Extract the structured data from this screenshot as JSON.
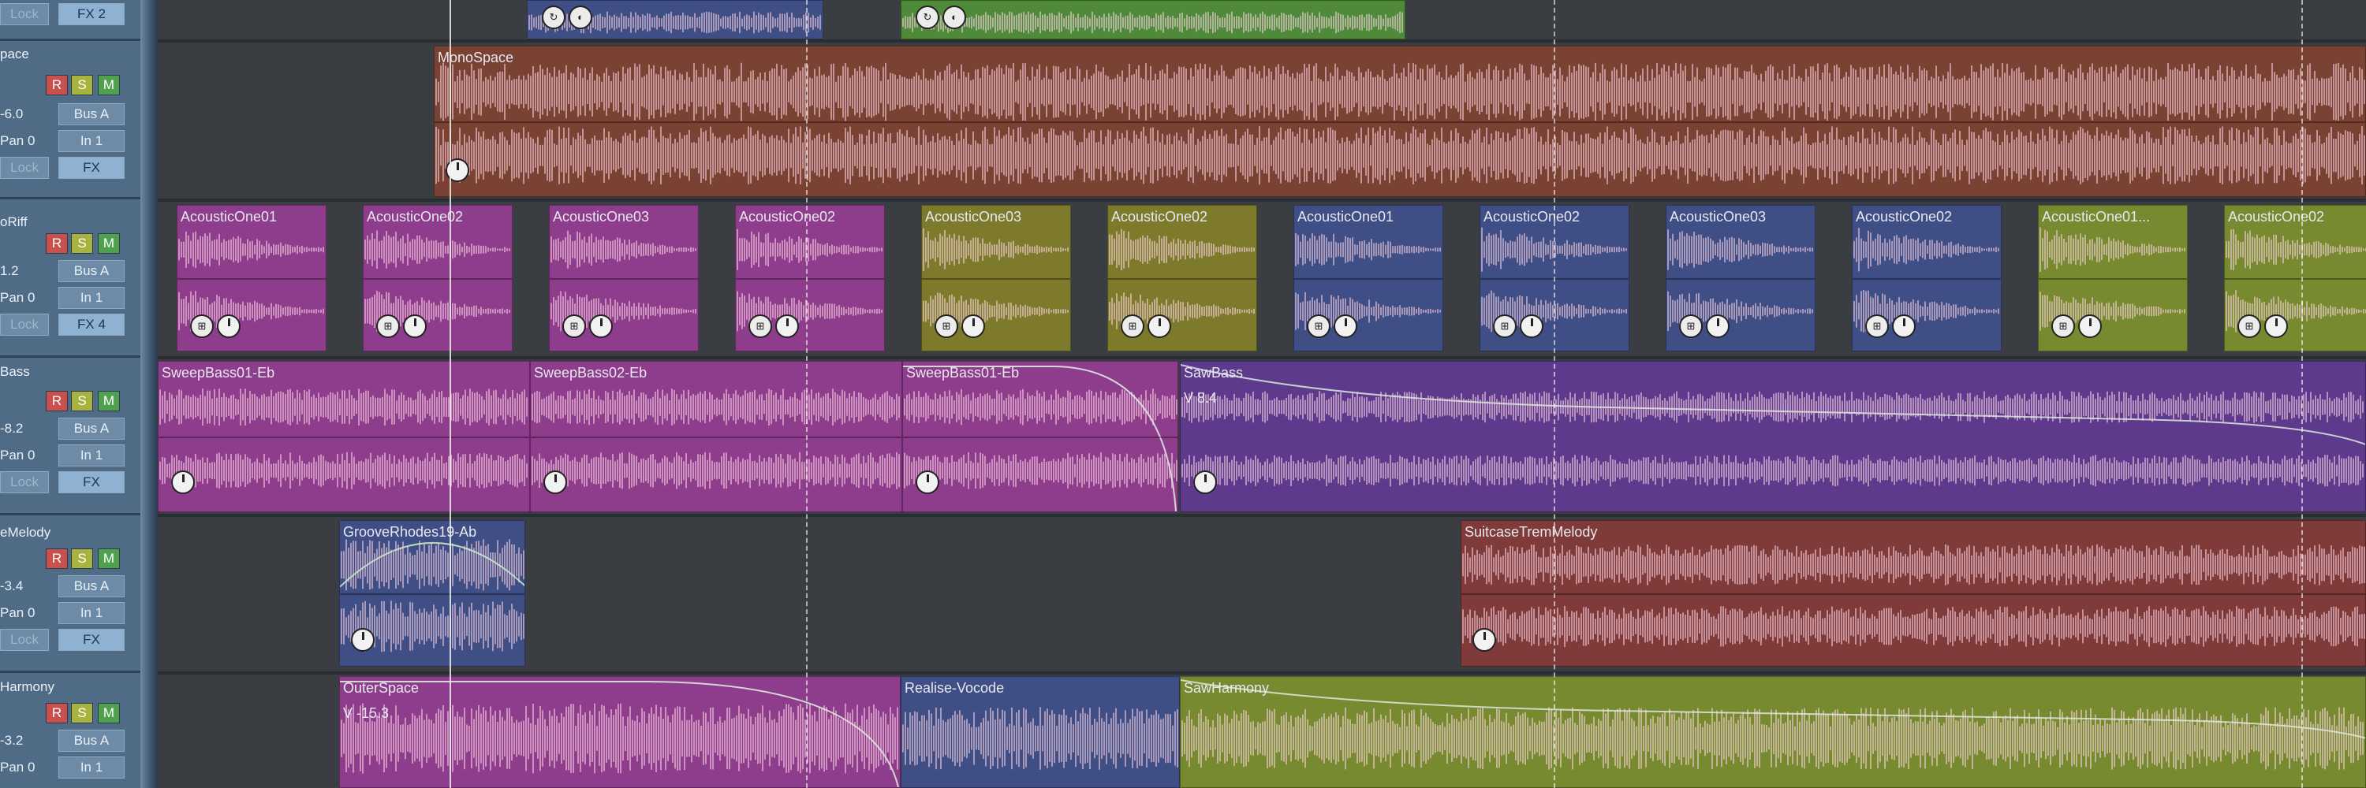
{
  "colors": {
    "header_bg": "#4f6b86",
    "timeline_bg": "#3a3d42",
    "blue_clip": "#3f4f86",
    "green_clip": "#4f8a3a",
    "brown_clip": "#7a4233",
    "magenta_clip": "#8e3d8c",
    "olive_clip": "#7d7a2c",
    "purple_clip": "#5d3a8c",
    "red_clip": "#7f3a3a",
    "yellowgreen_clip": "#788a30"
  },
  "tracks": [
    {
      "name": "",
      "lock": "Lock",
      "fx": "FX 2"
    },
    {
      "name": "pace",
      "r": "R",
      "s": "S",
      "m": "M",
      "volume": "-6.0",
      "bus": "Bus A",
      "pan": "Pan 0",
      "input": "In 1",
      "lock": "Lock",
      "fx": "FX"
    },
    {
      "name": "oRiff",
      "r": "R",
      "s": "S",
      "m": "M",
      "volume": "1.2",
      "bus": "Bus A",
      "pan": "Pan 0",
      "input": "In 1",
      "lock": "Lock",
      "fx": "FX 4"
    },
    {
      "name": "Bass",
      "r": "R",
      "s": "S",
      "m": "M",
      "volume": "-8.2",
      "bus": "Bus A",
      "pan": "Pan 0",
      "input": "In 1",
      "lock": "Lock",
      "fx": "FX"
    },
    {
      "name": "eMelody",
      "r": "R",
      "s": "S",
      "m": "M",
      "volume": "-3.4",
      "bus": "Bus A",
      "pan": "Pan 0",
      "input": "In 1",
      "lock": "Lock",
      "fx": "FX"
    },
    {
      "name": "Harmony",
      "r": "R",
      "s": "S",
      "m": "M",
      "volume": "-3.2",
      "bus": "Bus A",
      "pan": "Pan 0",
      "input": "In 1"
    }
  ],
  "clips": {
    "top_blue": "",
    "top_green": "",
    "monospace": "MonoSpace",
    "acoustic": [
      "AcousticOne01",
      "AcousticOne02",
      "AcousticOne03",
      "AcousticOne02",
      "AcousticOne03",
      "AcousticOne02",
      "AcousticOne01",
      "AcousticOne02",
      "AcousticOne03",
      "AcousticOne02",
      "AcousticOne01...",
      "AcousticOne02"
    ],
    "sweep1": "SweepBass01-Eb",
    "sweep2": "SweepBass02-Eb",
    "sweep3": "SweepBass01-Eb",
    "sawbass": "SawBass",
    "sawbass_vol": "V 8.4",
    "groove": "GrooveRhodes19-Ab",
    "suitcase": "SuitcaseTremMelody",
    "outerspace": "OuterSpace",
    "outerspace_vol": "V -15.3",
    "realise": "Realise-Vocode",
    "sawharmony": "SawHarmony"
  }
}
